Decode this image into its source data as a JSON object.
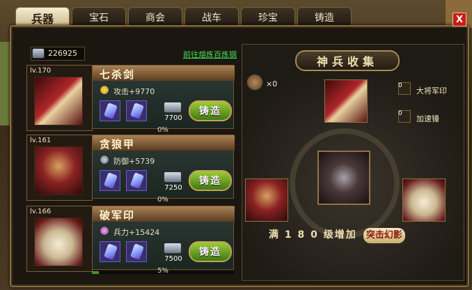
{
  "tabs": [
    {
      "label": "兵器",
      "active": true
    },
    {
      "label": "宝石",
      "active": false
    },
    {
      "label": "商会",
      "active": false
    },
    {
      "label": "战车",
      "active": false
    },
    {
      "label": "珍宝",
      "active": false
    },
    {
      "label": "铸造",
      "active": false
    }
  ],
  "close_label": "X",
  "resource": {
    "amount": "226925",
    "icon": "ore-icon",
    "link_text": "前往熔炼百炼钢"
  },
  "weapons": [
    {
      "level": "lv.170",
      "name": "七杀剑",
      "stat": "攻击+9770",
      "cost": "7700",
      "forge_label": "铸造",
      "progress_text": "0%",
      "progress": 0
    },
    {
      "level": "lv.161",
      "name": "贪狼甲",
      "stat": "防御+5739",
      "cost": "7250",
      "forge_label": "铸造",
      "progress_text": "0%",
      "progress": 0
    },
    {
      "level": "lv.166",
      "name": "破军印",
      "stat": "兵力+15424",
      "cost": "7500",
      "forge_label": "铸造",
      "progress_text": "5%",
      "progress": 0.05
    }
  ],
  "collection": {
    "title": "神兵收集",
    "hammer_count": "×0",
    "items": [
      {
        "count": "0",
        "label": "大将军印"
      },
      {
        "count": "0",
        "label": "加速锤"
      }
    ],
    "bonus_text": "满 1 8 0 级增加",
    "bonus_badge": "突击幻影"
  },
  "colors": {
    "accent": "#8a6d3b",
    "forge_button": "#7cb12a",
    "close": "#c81e14",
    "link": "#3ee05a"
  }
}
